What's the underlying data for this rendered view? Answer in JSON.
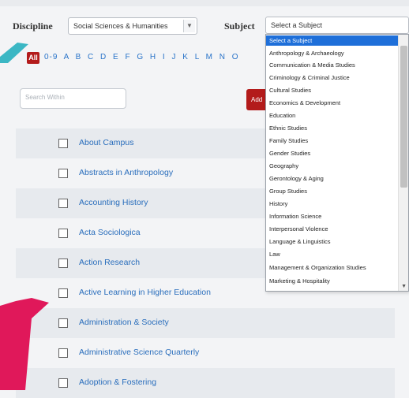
{
  "filters": {
    "discipline_label": "Discipline",
    "discipline_value": "Social Sciences & Humanities",
    "subject_label": "Subject",
    "subject_value": "Select a Subject"
  },
  "alpha": {
    "all_label": "All",
    "letters": "0-9 A B C D E F G H I J K L M N O"
  },
  "search": {
    "placeholder": "Search Within",
    "add_label": "Add"
  },
  "journals": [
    "About Campus",
    "Abstracts in Anthropology",
    "Accounting History",
    "Acta Sociologica",
    "Action Research",
    "Active Learning in Higher Education",
    "Administration & Society",
    "Administrative Science Quarterly",
    "Adoption & Fostering"
  ],
  "subject_options": [
    "Select a Subject",
    "Anthropology & Archaeology",
    "Communication & Media Studies",
    "Criminology & Criminal Justice",
    "Cultural Studies",
    "Economics & Development",
    "Education",
    "Ethnic Studies",
    "Family Studies",
    "Gender Studies",
    "Geography",
    "Gerontology & Aging",
    "Group Studies",
    "History",
    "Information Science",
    "Interpersonal Violence",
    "Language & Linguistics",
    "Law",
    "Management & Organization Studies",
    "Marketing & Hospitality"
  ],
  "colors": {
    "accent_red": "#b31b1b",
    "link_blue": "#2a6ebc",
    "selected_blue": "#1e6fd9",
    "callout_teal": "#3bb7c4",
    "callout_pink": "#e0185a"
  }
}
